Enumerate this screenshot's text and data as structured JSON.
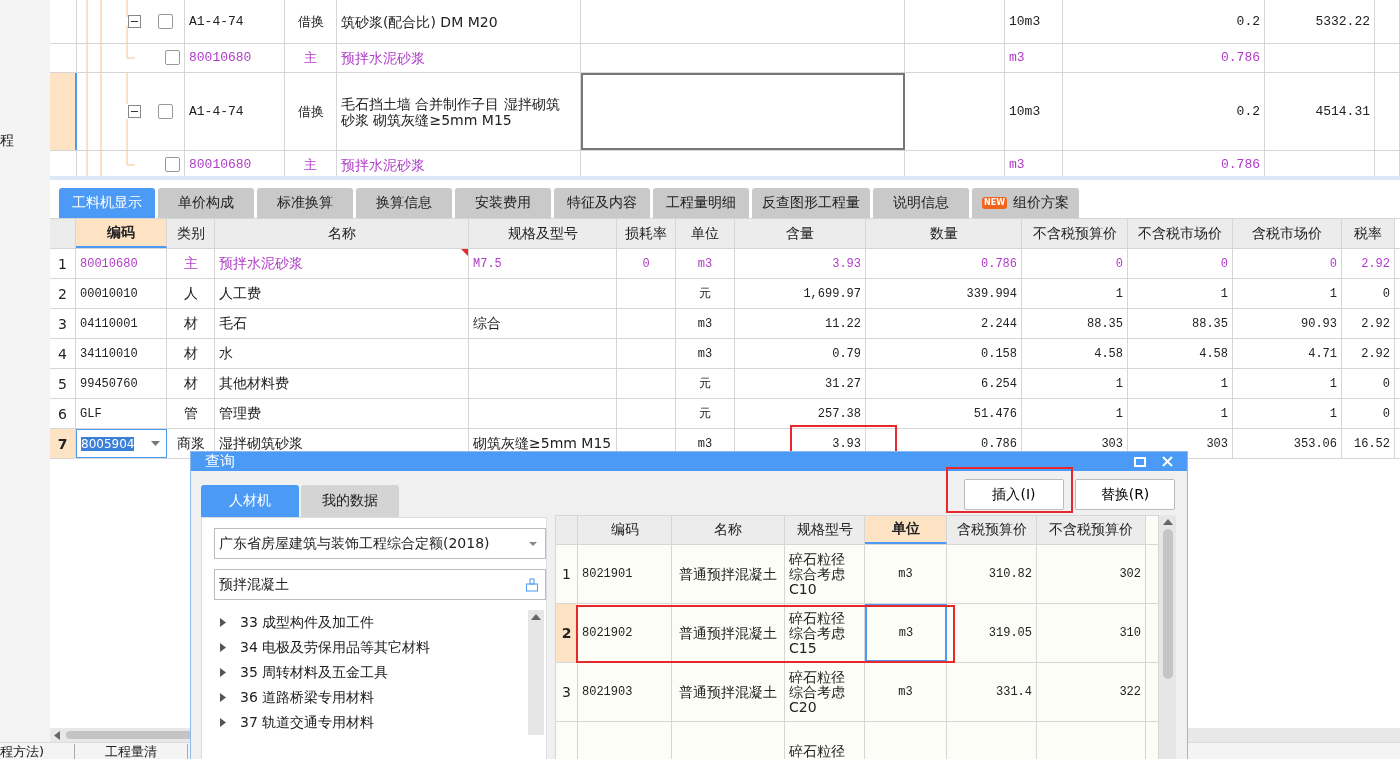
{
  "sidebar": {
    "items": [
      "程"
    ]
  },
  "upper_grid": {
    "rows": [
      {
        "kind": "item",
        "code": "A1-4-74",
        "type": "借换",
        "name": "筑砂浆(配合比) DM M20",
        "unit": "10m3",
        "qty": "0.2",
        "price": "5332.22",
        "selected": false,
        "checked": false
      },
      {
        "kind": "sub",
        "code": "80010680",
        "type": "主",
        "name": "预拌水泥砂浆",
        "unit": "m3",
        "qty": "0.786",
        "selected": false,
        "checked": false
      },
      {
        "kind": "item",
        "code": "A1-4-74",
        "type": "借换",
        "name": "毛石挡土墙  合并制作子目 湿拌砌筑砂浆 砌筑灰缝≥5mm M15",
        "unit": "10m3",
        "qty": "0.2",
        "price": "4514.31",
        "selected": true,
        "checked": false
      },
      {
        "kind": "sub",
        "code": "80010680",
        "type": "主",
        "name": "预拌水泥砂浆",
        "unit": "m3",
        "qty": "0.786",
        "selected": false,
        "checked": false
      }
    ]
  },
  "tabs": [
    {
      "label": "工料机显示",
      "selected": true
    },
    {
      "label": "单价构成",
      "selected": false
    },
    {
      "label": "标准换算",
      "selected": false
    },
    {
      "label": "换算信息",
      "selected": false
    },
    {
      "label": "安装费用",
      "selected": false
    },
    {
      "label": "特征及内容",
      "selected": false
    },
    {
      "label": "工程量明细",
      "selected": false
    },
    {
      "label": "反查图形工程量",
      "selected": false
    },
    {
      "label": "说明信息",
      "selected": false
    },
    {
      "label": "组价方案",
      "selected": false,
      "badge": "NEW"
    }
  ],
  "table": {
    "columns": [
      {
        "label": "编码",
        "sorted": true
      },
      {
        "label": "类别",
        "sorted": false
      },
      {
        "label": "名称",
        "sorted": false
      },
      {
        "label": "规格及型号",
        "sorted": false
      },
      {
        "label": "损耗率",
        "sorted": false
      },
      {
        "label": "单位",
        "sorted": false
      },
      {
        "label": "含量",
        "sorted": false
      },
      {
        "label": "数量",
        "sorted": false
      },
      {
        "label": "不含税预算价",
        "sorted": false
      },
      {
        "label": "不含税市场价",
        "sorted": false
      },
      {
        "label": "含税市场价",
        "sorted": false
      },
      {
        "label": "税率",
        "sorted": false
      }
    ],
    "rows": [
      {
        "kind": "main",
        "selected": false,
        "highlighted": false,
        "num": "1",
        "cells": [
          "80010680",
          "主",
          "预拌水泥砂浆",
          "M7.5",
          "0",
          "m3",
          "3.93",
          "0.786",
          "0",
          "0",
          "0",
          "2.92"
        ]
      },
      {
        "kind": "normal",
        "selected": false,
        "highlighted": false,
        "num": "2",
        "cells": [
          "00010010",
          "人",
          "人工费",
          "",
          "",
          "元",
          "1,699.97",
          "339.994",
          "1",
          "1",
          "1",
          "0"
        ]
      },
      {
        "kind": "normal",
        "selected": false,
        "highlighted": false,
        "num": "3",
        "cells": [
          "04110001",
          "材",
          "毛石",
          "综合",
          "",
          "m3",
          "11.22",
          "2.244",
          "88.35",
          "88.35",
          "90.93",
          "2.92"
        ]
      },
      {
        "kind": "normal",
        "selected": false,
        "highlighted": false,
        "num": "4",
        "cells": [
          "34110010",
          "材",
          "水",
          "",
          "",
          "m3",
          "0.79",
          "0.158",
          "4.58",
          "4.58",
          "4.71",
          "2.92"
        ]
      },
      {
        "kind": "normal",
        "selected": false,
        "highlighted": false,
        "num": "5",
        "cells": [
          "99450760",
          "材",
          "其他材料费",
          "",
          "",
          "元",
          "31.27",
          "6.254",
          "1",
          "1",
          "1",
          "0"
        ]
      },
      {
        "kind": "normal",
        "selected": false,
        "highlighted": false,
        "num": "6",
        "cells": [
          "GLF",
          "管",
          "管理费",
          "",
          "",
          "元",
          "257.38",
          "51.476",
          "1",
          "1",
          "1",
          "0"
        ]
      },
      {
        "kind": "normal",
        "selected": true,
        "highlighted": true,
        "num": "7",
        "cells": [
          "8005904",
          "商浆",
          "湿拌砌筑砂浆",
          "砌筑灰缝≥5mm M15",
          "",
          "m3",
          "3.93",
          "0.786",
          "303",
          "303",
          "353.06",
          "16.52"
        ]
      }
    ]
  },
  "status_bar": {
    "items": [
      "程方法)",
      "工程量清"
    ]
  },
  "dialog": {
    "title": "查询",
    "tabs": [
      {
        "label": "人材机",
        "selected": true
      },
      {
        "label": "我的数据",
        "selected": false
      }
    ],
    "library": "广东省房屋建筑与装饰工程综合定额(2018)",
    "search": "预拌混凝土",
    "tree": [
      {
        "label": "33 成型构件及加工件",
        "expanded": false
      },
      {
        "label": "34 电极及劳保用品等其它材料",
        "expanded": false
      },
      {
        "label": "35 周转材料及五金工具",
        "expanded": false
      },
      {
        "label": "36 道路桥梁专用材料",
        "expanded": false
      },
      {
        "label": "37 轨道交通专用材料",
        "expanded": false
      }
    ],
    "buttons": [
      {
        "label": "插入(I)",
        "highlighted": true
      },
      {
        "label": "替换(R)",
        "highlighted": false
      }
    ],
    "grid": {
      "columns": [
        {
          "label": "编码",
          "sorted": false
        },
        {
          "label": "名称",
          "sorted": false
        },
        {
          "label": "规格型号",
          "sorted": false
        },
        {
          "label": "单位",
          "sorted": true
        },
        {
          "label": "含税预算价",
          "sorted": false
        },
        {
          "label": "不含税预算价",
          "sorted": false
        }
      ],
      "rows": [
        {
          "selected": false,
          "highlighted": false,
          "num": "1",
          "cells": [
            "8021901",
            "普通预拌混凝土",
            "碎石粒径综合考虑C10",
            "m3",
            "310.82",
            "302"
          ]
        },
        {
          "selected": true,
          "highlighted": true,
          "num": "2",
          "cells": [
            "8021902",
            "普通预拌混凝土",
            "碎石粒径综合考虑C15",
            "m3",
            "319.05",
            "310"
          ]
        },
        {
          "selected": false,
          "highlighted": false,
          "num": "3",
          "cells": [
            "8021903",
            "普通预拌混凝土",
            "碎石粒径综合考虑C20",
            "m3",
            "331.4",
            "322"
          ]
        },
        {
          "selected": false,
          "highlighted": false,
          "cells": [
            "",
            "",
            "碎石粒径",
            "",
            "",
            ""
          ]
        }
      ]
    }
  }
}
